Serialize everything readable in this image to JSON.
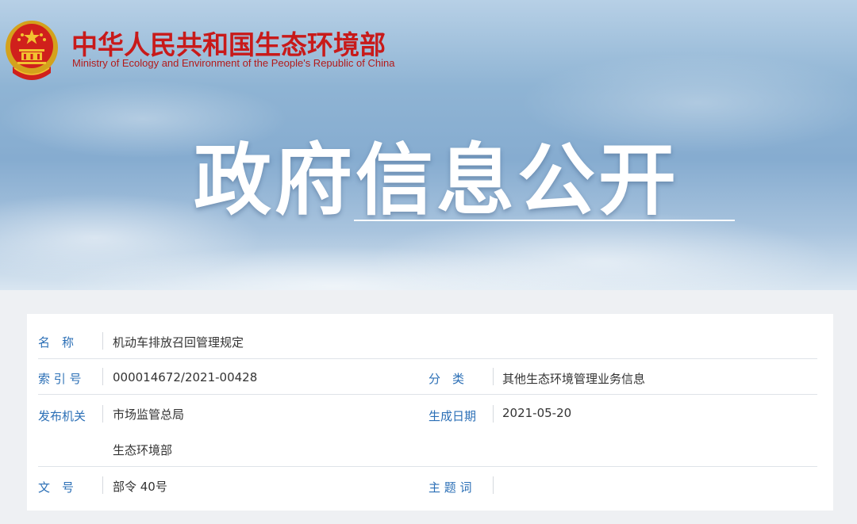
{
  "header": {
    "ministry_cn": "中华人民共和国生态环境部",
    "ministry_en": "Ministry of Ecology and Environment of the People's Republic of China",
    "emblem_icon": "national-emblem-icon"
  },
  "banner": {
    "title": "政府信息公开"
  },
  "info": {
    "name_label": "名　称",
    "name_value": "机动车排放召回管理规定",
    "index_label": "索 引 号",
    "index_value": "000014672/2021-00428",
    "category_label": "分　类",
    "category_value": "其他生态环境管理业务信息",
    "issuer_label": "发布机关",
    "issuer_values": [
      "市场监管总局",
      "生态环境部"
    ],
    "date_label": "生成日期",
    "date_value": "2021-05-20",
    "doc_no_label": "文　号",
    "doc_no_value": "部令 40号",
    "keywords_label": "主 题 词",
    "keywords_value": ""
  },
  "colors": {
    "ministry_red": "#c81a1a",
    "label_blue": "#2b6fb6",
    "value_text": "#333333"
  }
}
